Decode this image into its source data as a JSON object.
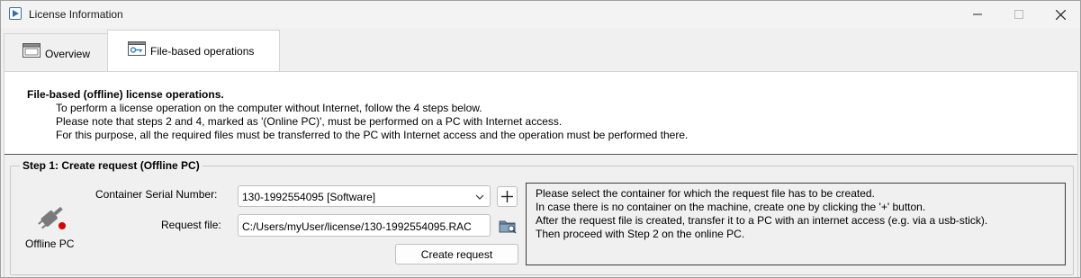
{
  "window": {
    "title": "License Information"
  },
  "tabs": [
    {
      "label": "Overview",
      "icon": "window-icon"
    },
    {
      "label": "File-based operations",
      "icon": "license-key-icon"
    }
  ],
  "intro": {
    "title": "File-based (offline) license operations.",
    "lines": [
      "To perform a license operation on the computer without Internet, follow the 4 steps below.",
      "Please note that steps 2 and 4, marked as '(Online PC)', must be performed on a PC with Internet access.",
      "For this purpose, all the required files must be transferred to the PC with Internet access and the operation must be performed there."
    ]
  },
  "step1": {
    "legend": "Step 1: Create request (Offline PC)",
    "pc_label": "Offline PC",
    "container_label": "Container Serial Number:",
    "container_value": "130-1992554095 [Software]",
    "request_label": "Request file:",
    "request_value": "C:/Users/myUser/license/130-1992554095.RAC",
    "create_button": "Create request",
    "info_lines": [
      "Please select the container for which the request file has to be created.",
      "In case there is no container on the machine, create one by clicking the '+' button.",
      "After the request file is created, transfer it to a PC with an internet access (e.g. via a usb-stick).",
      "Then proceed with Step 2 on the online PC."
    ]
  },
  "colors": {
    "status_dot": "#d40000",
    "plug_gray": "#7a7a7a"
  }
}
